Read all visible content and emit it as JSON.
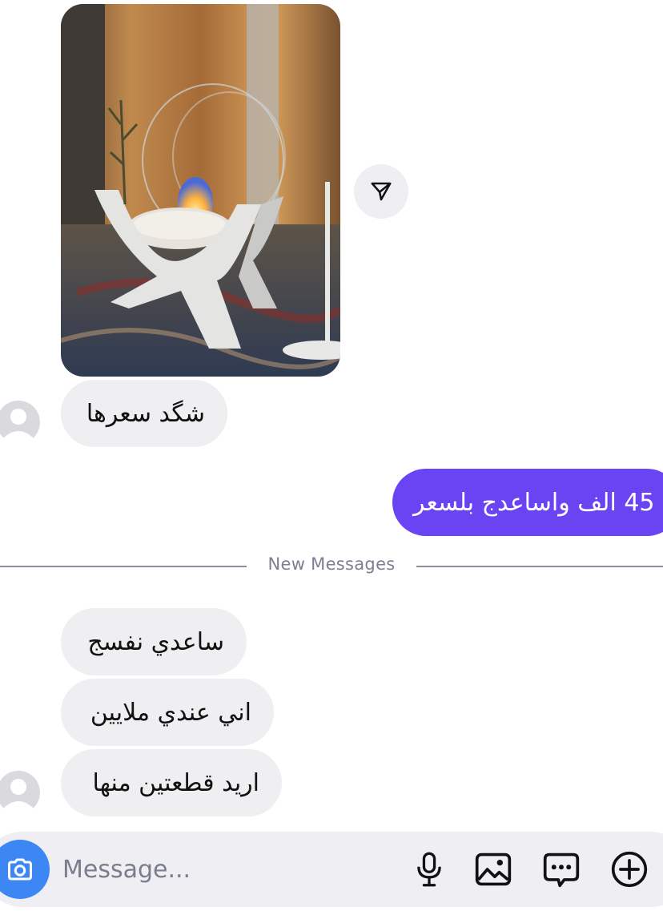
{
  "messages": [
    {
      "id": "m1",
      "sender": "them",
      "type": "image",
      "image_icon": "fireplace-photo"
    },
    {
      "id": "m2",
      "sender": "them",
      "type": "text",
      "text": "شگد سعرها"
    },
    {
      "id": "m3",
      "sender": "me",
      "type": "text",
      "text": "45 الف واساعدج بلسعر"
    },
    {
      "id": "m4",
      "sender": "them",
      "type": "text",
      "text": "ساعدي نفسج"
    },
    {
      "id": "m5",
      "sender": "them",
      "type": "text",
      "text": "اني عندي ملايين"
    },
    {
      "id": "m6",
      "sender": "them",
      "type": "text",
      "text": "اريد قطعتين منها"
    }
  ],
  "divider": {
    "label": "New Messages"
  },
  "composer": {
    "placeholder": "Message...",
    "icons": [
      "camera-icon",
      "microphone-icon",
      "gallery-icon",
      "sticker-chat-icon",
      "plus-icon"
    ]
  },
  "colors": {
    "outgoing_bubble": "#6a44f2",
    "incoming_bubble": "#efeff1",
    "camera_button": "#3d87f5",
    "divider": "#8b8fa2"
  }
}
